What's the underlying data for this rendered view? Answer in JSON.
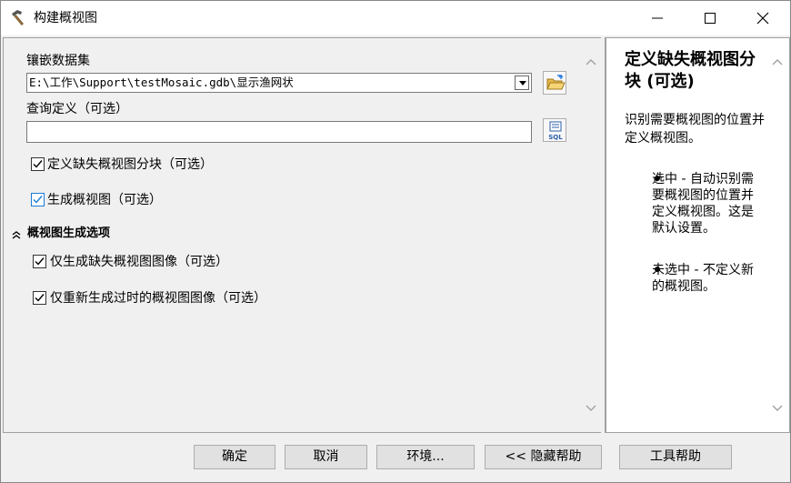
{
  "window": {
    "title": "构建概视图"
  },
  "params": {
    "mosaic_label": "镶嵌数据集",
    "mosaic_value": "E:\\工作\\Support\\testMosaic.gdb\\显示渔网状",
    "query_label": "查询定义（可选）",
    "query_value": "",
    "sql_label": "SQL",
    "define_tiles_label": "定义缺失概视图分块（可选）",
    "define_tiles_checked": true,
    "generate_label": "生成概视图（可选）",
    "generate_checked": true,
    "group_title": "概视图生成选项",
    "gen_missing_label": "仅生成缺失概视图图像（可选）",
    "gen_missing_checked": true,
    "regen_stale_label": "仅重新生成过时的概视图图像（可选）",
    "regen_stale_checked": true
  },
  "help": {
    "title": "定义缺失概视图分块 (可选)",
    "description": "识别需要概视图的位置并定义概视图。",
    "bullets": [
      "选中 - 自动识别需要概视图的位置并定义概视图。这是默认设置。",
      "未选中 - 不定义新的概视图。"
    ]
  },
  "buttons": {
    "ok": "确定",
    "cancel": "取消",
    "environments": "环境...",
    "hide_help": "<< 隐藏帮助",
    "tool_help": "工具帮助"
  }
}
